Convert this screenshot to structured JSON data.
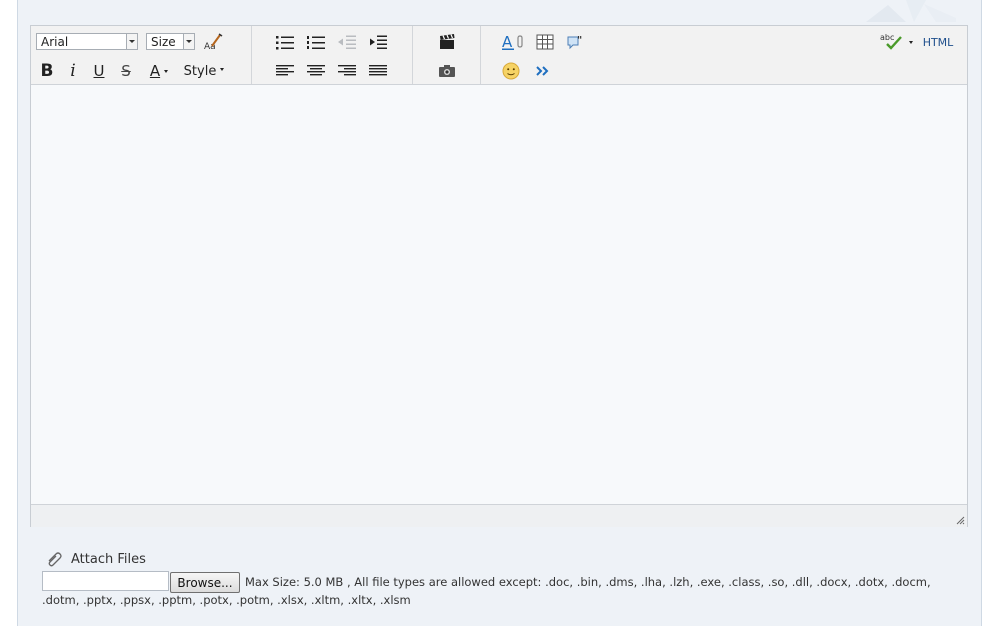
{
  "toolbar": {
    "font_family": "Arial",
    "font_size": "Size",
    "style_label": "Style",
    "html_label": "HTML",
    "icons": {
      "font_family_dropdown": "dropdown-arrow-icon",
      "font_size_dropdown": "dropdown-arrow-icon",
      "clear_format": "clear-formatting-icon",
      "bold": "B",
      "italic": "i",
      "underline": "U",
      "strikethrough": "S",
      "font_color": "A",
      "bullet_list": "bulleted-list-icon",
      "numbered_list": "numbered-list-icon",
      "outdent": "outdent-icon",
      "indent": "indent-icon",
      "align_left": "align-left-icon",
      "align_center": "align-center-icon",
      "align_right": "align-right-icon",
      "justify": "justify-icon",
      "video": "film-clapper-icon",
      "image": "camera-icon",
      "attachment_link": "insert-attachment-icon",
      "table": "table-icon",
      "quote": "quote-icon",
      "smiley": "smiley-icon",
      "more": "double-chevron-right-icon",
      "spellcheck": "spellcheck-icon"
    },
    "colors": {
      "font_color_underline": "#d60000",
      "link_blue": "#1f6fc0"
    }
  },
  "editor": {
    "content": ""
  },
  "attachments": {
    "title": "Attach Files",
    "browse_label": "Browse...",
    "file_value": "",
    "max_size_note": "Max Size: 5.0 MB , All file types are allowed except: .doc, .bin, .dms, .lha, .lzh, .exe, .class, .so, .dll, .docx, .dotx, .docm, .dotm, .pptx, .ppsx, .pptm, .potx, .potm, .xlsx, .xltm, .xltx, .xlsm"
  }
}
